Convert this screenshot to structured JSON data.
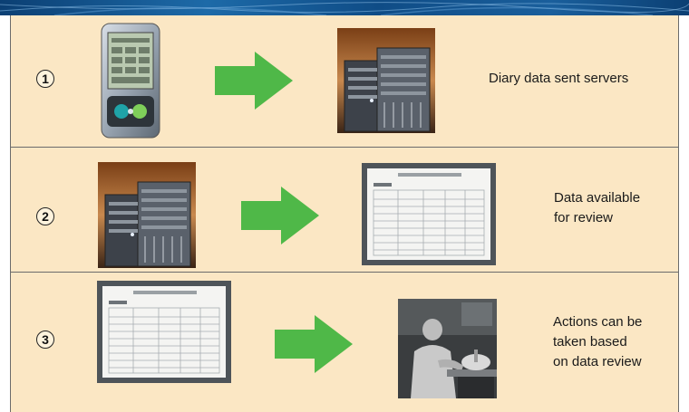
{
  "header": {
    "accent": "#1a5f9c"
  },
  "colors": {
    "panel": "#fbe7c4",
    "arrow": "#4fb848",
    "divider": "#6b6b6b"
  },
  "steps": [
    {
      "number": "1",
      "from_image": "handheld-pda",
      "to_image": "server-racks",
      "caption_lines": [
        "Diary data sent servers"
      ]
    },
    {
      "number": "2",
      "from_image": "server-racks",
      "to_image": "data-table-screen",
      "caption_lines": [
        "Data available",
        "for review"
      ]
    },
    {
      "number": "3",
      "from_image": "data-table-screen",
      "to_image": "person-reviewing-photo",
      "caption_lines": [
        "Actions can be",
        "taken based",
        "on data review"
      ]
    }
  ]
}
